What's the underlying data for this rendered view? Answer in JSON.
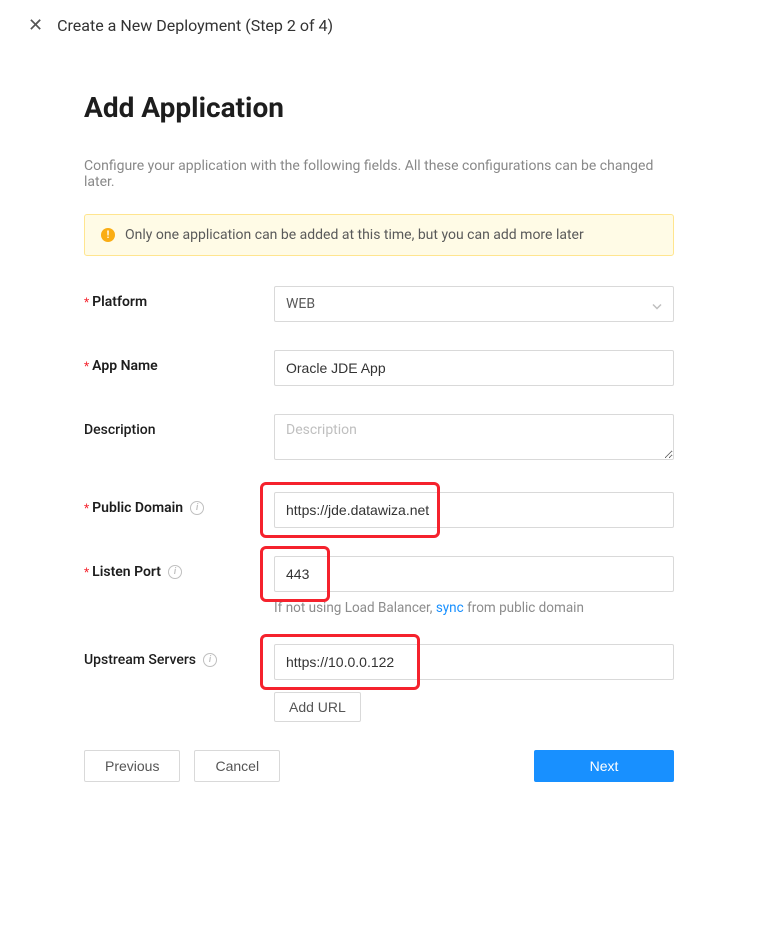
{
  "header": {
    "title": "Create a New Deployment (Step 2 of 4)"
  },
  "page": {
    "title": "Add Application",
    "subtitle": "Configure your application with the following fields. All these configurations can be changed later."
  },
  "alert": {
    "text": "Only one application can be added at this time, but you can add more later"
  },
  "form": {
    "platform": {
      "label": "Platform",
      "value": "WEB",
      "required": true
    },
    "app_name": {
      "label": "App Name",
      "value": "Oracle JDE App",
      "required": true
    },
    "description": {
      "label": "Description",
      "value": "",
      "placeholder": "Description",
      "required": false
    },
    "public_domain": {
      "label": "Public Domain",
      "value": "https://jde.datawiza.net",
      "required": true
    },
    "listen_port": {
      "label": "Listen Port",
      "value": "443",
      "required": true,
      "hint_prefix": "If not using Load Balancer, ",
      "hint_link": "sync",
      "hint_suffix": " from public domain"
    },
    "upstream": {
      "label": "Upstream Servers",
      "value": "https://10.0.0.122",
      "add_url_label": "Add URL"
    }
  },
  "footer": {
    "previous": "Previous",
    "cancel": "Cancel",
    "next": "Next"
  }
}
